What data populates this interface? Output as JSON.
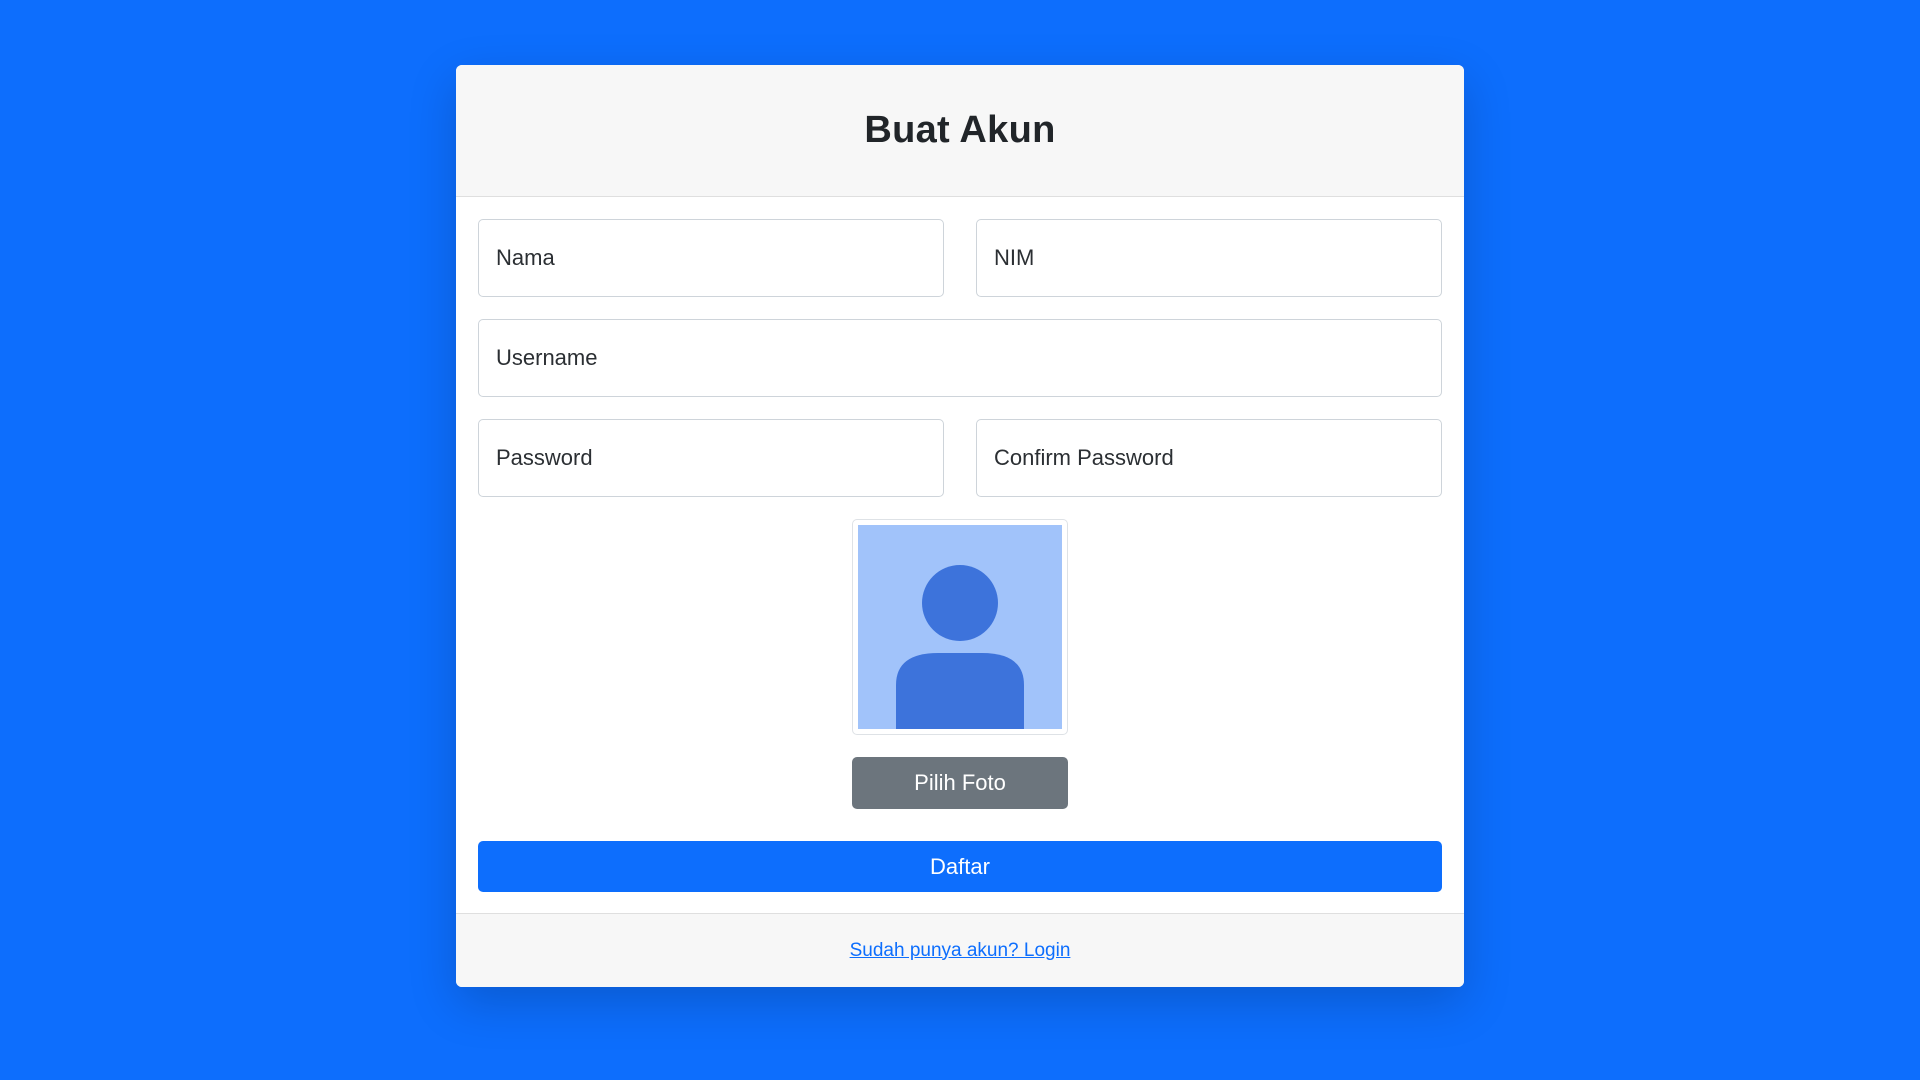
{
  "header": {
    "title": "Buat Akun"
  },
  "form": {
    "nama_placeholder": "Nama",
    "nim_placeholder": "NIM",
    "username_placeholder": "Username",
    "password_placeholder": "Password",
    "confirm_password_placeholder": "Confirm Password",
    "photo_icon": "user-avatar-placeholder-icon",
    "choose_photo_label": "Pilih Foto",
    "submit_label": "Daftar"
  },
  "footer": {
    "login_link": "Sudah punya akun? Login"
  },
  "colors": {
    "background": "#0d6efd",
    "primary_button": "#0d6efd",
    "secondary_button": "#6c757d",
    "avatar_bg": "#a1c3fa",
    "avatar_fg": "#3d73db"
  }
}
